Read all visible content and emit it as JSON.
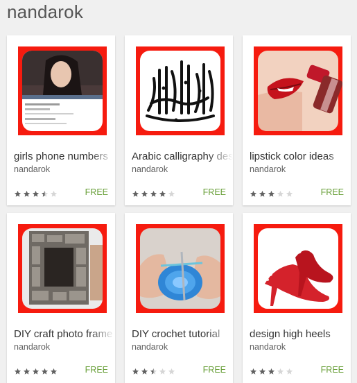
{
  "developer": {
    "name": "nandarok"
  },
  "apps": [
    {
      "title": "girls phone numbers",
      "developer": "nandarok",
      "price": "FREE",
      "rating": 3.5,
      "icon": "girl-portrait-icon"
    },
    {
      "title": "Arabic calligraphy designs",
      "developer": "nandarok",
      "price": "FREE",
      "rating": 4,
      "icon": "arabic-calligraphy-icon"
    },
    {
      "title": "lipstick color ideas",
      "developer": "nandarok",
      "price": "FREE",
      "rating": 3,
      "icon": "lipstick-icon"
    },
    {
      "title": "DIY craft photo frame",
      "developer": "nandarok",
      "price": "FREE",
      "rating": 5,
      "icon": "mosaic-frame-icon"
    },
    {
      "title": "DIY crochet tutorial",
      "developer": "nandarok",
      "price": "FREE",
      "rating": 2.5,
      "icon": "crochet-hands-icon"
    },
    {
      "title": "design high heels",
      "developer": "nandarok",
      "price": "FREE",
      "rating": 3,
      "icon": "red-heels-icon"
    }
  ],
  "colors": {
    "thumb_background": "#f61b0f",
    "price": "#689f38",
    "star_filled": "#616161",
    "star_empty": "#d6d6d6"
  }
}
